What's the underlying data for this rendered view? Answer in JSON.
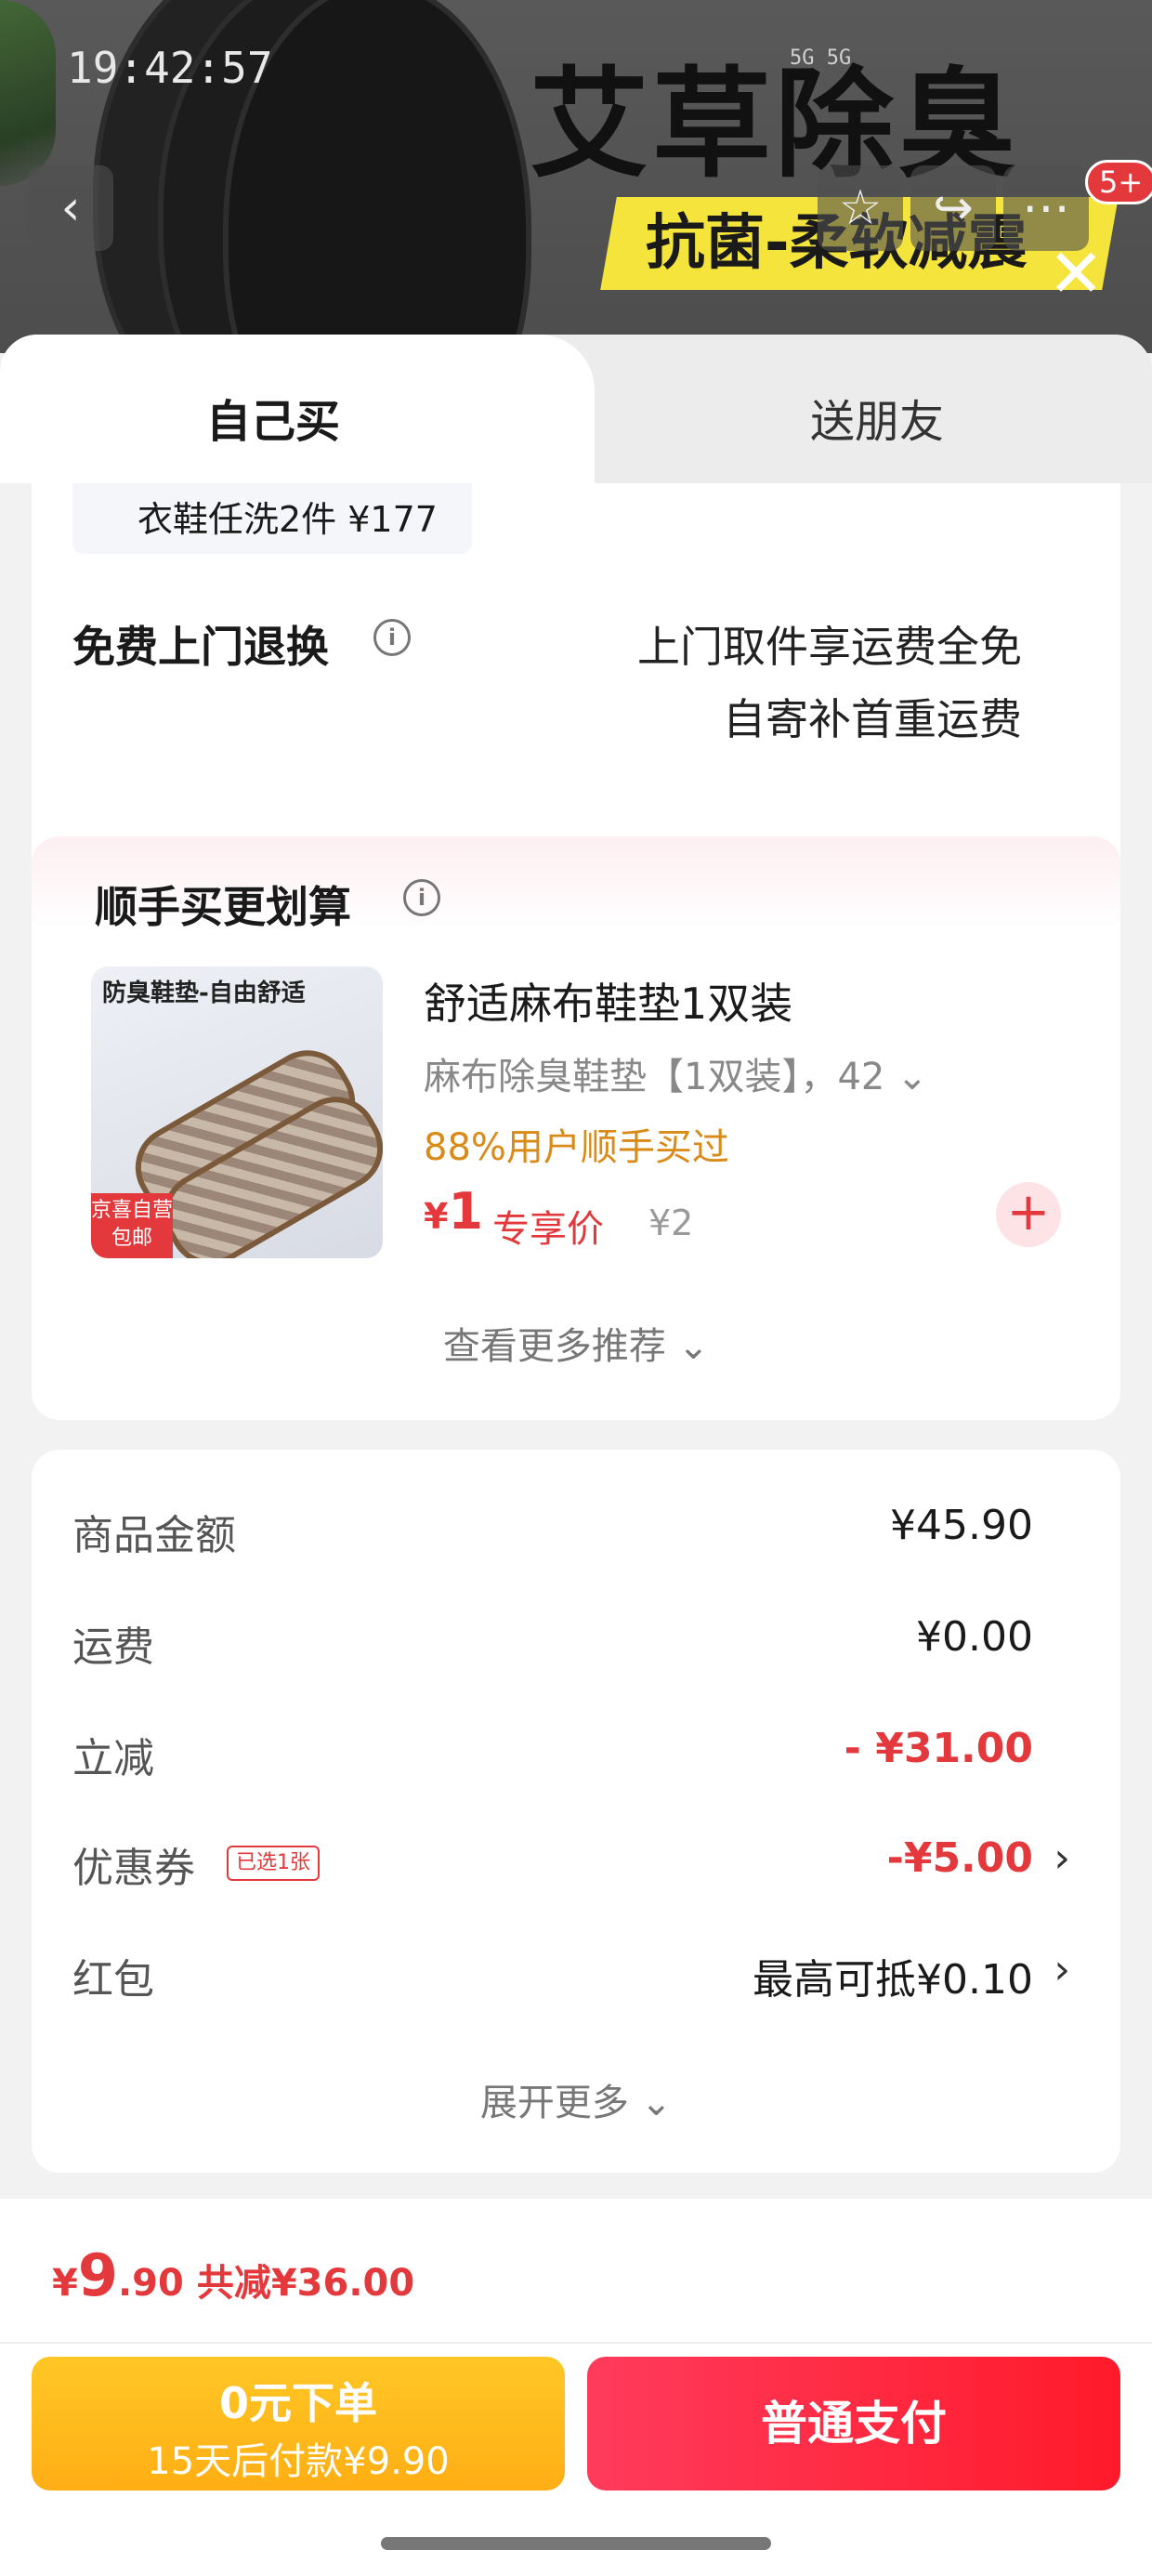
{
  "status_bar": {
    "time": "19:42:57",
    "network": "5G  5G"
  },
  "banner": {
    "title": "艾草除臭",
    "slogan": "抗菌-柔软减震",
    "badge": "5+"
  },
  "tabs": {
    "self": "自己买",
    "gift": "送朋友"
  },
  "promo": {
    "text": "衣鞋任洗2件  ¥177"
  },
  "return": {
    "label": "免费上门退换",
    "line1": "上门取件享运费全免",
    "line2": "自寄补首重运费"
  },
  "addon": {
    "title": "顺手买更划算",
    "thumb_head": "防臭鞋垫-自由舒适",
    "thumb_tag": "京喜自营 包邮",
    "name": "舒适麻布鞋垫1双装",
    "spec": "麻布除臭鞋垫【1双装】，42",
    "buy_rate": "88%用户顺手买过",
    "price_cur": "¥",
    "price": "1",
    "price_label": "专享价",
    "orig_price": "¥2",
    "more": "查看更多推荐"
  },
  "summary": {
    "goods_label": "商品金额",
    "goods_value": "¥45.90",
    "ship_label": "运费",
    "ship_value": "¥0.00",
    "cut_label": "立减",
    "cut_value": "- ¥31.00",
    "coupon_label": "优惠券",
    "coupon_tag": "已选1张",
    "coupon_value": "-¥5.00",
    "redpack_label": "红包",
    "redpack_value": "最高可抵¥0.10",
    "expand": "展开更多"
  },
  "bottom": {
    "cur": "¥",
    "total_int": "9",
    "total_dec": ".90",
    "reduce": "共减¥36.00",
    "zero_l1": "0元下单",
    "zero_l2": "15天后付款¥9.90",
    "pay": "普通支付"
  }
}
